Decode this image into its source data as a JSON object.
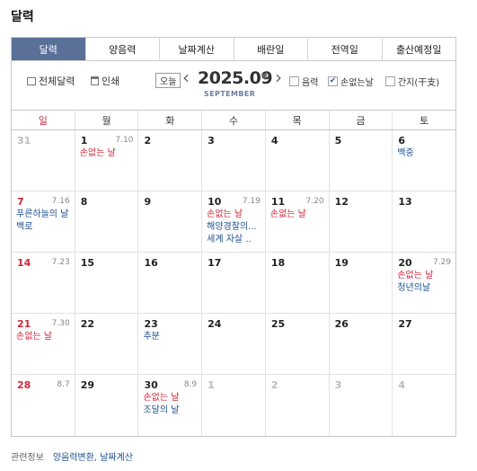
{
  "title": "달력",
  "tabs": [
    {
      "label": "달력",
      "active": true
    },
    {
      "label": "양음력",
      "active": false
    },
    {
      "label": "날짜계산",
      "active": false
    },
    {
      "label": "배란일",
      "active": false
    },
    {
      "label": "전역일",
      "active": false
    },
    {
      "label": "출산예정일",
      "active": false
    }
  ],
  "toolbar": {
    "full_calendar": "전체달력",
    "print": "인쇄",
    "today": "오늘",
    "year_month": "2025.09",
    "month_en": "SEPTEMBER",
    "lunar_label": "음력",
    "lunar_checked": false,
    "noghost_label": "손없는날",
    "noghost_checked": true,
    "ganji_label": "간지(干支)",
    "ganji_checked": false
  },
  "weekdays": [
    "일",
    "월",
    "화",
    "수",
    "목",
    "금",
    "토"
  ],
  "weeks": [
    [
      {
        "num": "31",
        "other": true,
        "lunar": "",
        "events": []
      },
      {
        "num": "1",
        "lunar": "7.10",
        "events": [
          {
            "text": "손없는 날",
            "color": "red"
          }
        ]
      },
      {
        "num": "2",
        "lunar": "",
        "events": []
      },
      {
        "num": "3",
        "lunar": "",
        "events": []
      },
      {
        "num": "4",
        "lunar": "",
        "events": []
      },
      {
        "num": "5",
        "lunar": "",
        "events": []
      },
      {
        "num": "6",
        "lunar": "",
        "events": [
          {
            "text": "백중",
            "color": "blue"
          }
        ]
      }
    ],
    [
      {
        "num": "7",
        "sun": true,
        "lunar": "7.16",
        "events": [
          {
            "text": "푸른하늘의 날",
            "color": "blue",
            "wrap": true
          },
          {
            "text": "백로",
            "color": "blue"
          }
        ]
      },
      {
        "num": "8",
        "lunar": "",
        "events": []
      },
      {
        "num": "9",
        "lunar": "",
        "events": []
      },
      {
        "num": "10",
        "lunar": "7.19",
        "events": [
          {
            "text": "손없는 날",
            "color": "red"
          },
          {
            "text": "해양경찰의...",
            "color": "blue"
          },
          {
            "text": "세계 자살 ..",
            "color": "blue"
          }
        ]
      },
      {
        "num": "11",
        "lunar": "7.20",
        "events": [
          {
            "text": "손없는 날",
            "color": "red"
          }
        ]
      },
      {
        "num": "12",
        "lunar": "",
        "events": []
      },
      {
        "num": "13",
        "lunar": "",
        "events": []
      }
    ],
    [
      {
        "num": "14",
        "sun": true,
        "lunar": "7.23",
        "events": []
      },
      {
        "num": "15",
        "lunar": "",
        "events": []
      },
      {
        "num": "16",
        "lunar": "",
        "events": []
      },
      {
        "num": "17",
        "lunar": "",
        "events": []
      },
      {
        "num": "18",
        "lunar": "",
        "events": []
      },
      {
        "num": "19",
        "lunar": "",
        "events": []
      },
      {
        "num": "20",
        "lunar": "7.29",
        "events": [
          {
            "text": "손없는 날",
            "color": "red"
          },
          {
            "text": "청년의날",
            "color": "blue"
          }
        ]
      }
    ],
    [
      {
        "num": "21",
        "sun": true,
        "lunar": "7.30",
        "events": [
          {
            "text": "손없는 날",
            "color": "red"
          }
        ]
      },
      {
        "num": "22",
        "lunar": "",
        "events": []
      },
      {
        "num": "23",
        "lunar": "",
        "events": [
          {
            "text": "추분",
            "color": "blue"
          }
        ]
      },
      {
        "num": "24",
        "lunar": "",
        "events": []
      },
      {
        "num": "25",
        "lunar": "",
        "events": []
      },
      {
        "num": "26",
        "lunar": "",
        "events": []
      },
      {
        "num": "27",
        "lunar": "",
        "events": []
      }
    ],
    [
      {
        "num": "28",
        "sun": true,
        "lunar": "8.7",
        "events": []
      },
      {
        "num": "29",
        "lunar": "",
        "events": []
      },
      {
        "num": "30",
        "lunar": "8.9",
        "events": [
          {
            "text": "손없는 날",
            "color": "red"
          },
          {
            "text": "조달의 날",
            "color": "blue"
          }
        ]
      },
      {
        "num": "1",
        "other": true,
        "lunar": "",
        "events": []
      },
      {
        "num": "2",
        "other": true,
        "lunar": "",
        "events": []
      },
      {
        "num": "3",
        "other": true,
        "lunar": "",
        "events": []
      },
      {
        "num": "4",
        "other": true,
        "lunar": "",
        "events": []
      }
    ]
  ],
  "related": {
    "label": "관련정보",
    "links": "양음력변환, 날짜계산"
  },
  "colors": {
    "accent": "#5a7098",
    "sunday": "#d0263b",
    "event_blue": "#1d4f91"
  }
}
